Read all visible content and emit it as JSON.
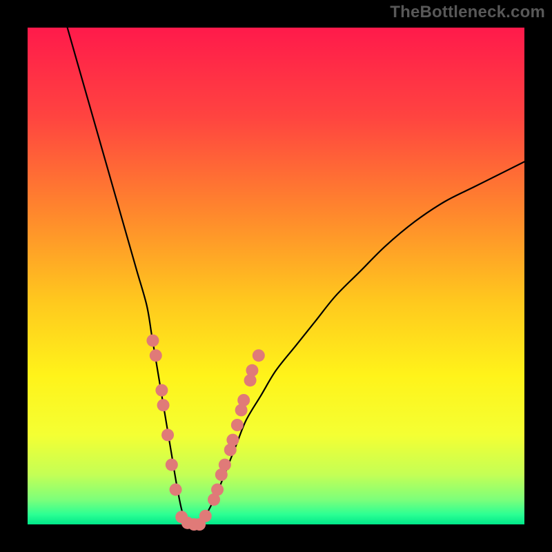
{
  "watermark": "TheBottleneck.com",
  "gradient_stops": [
    {
      "offset": 0,
      "color": "#ff1a4b"
    },
    {
      "offset": 18,
      "color": "#ff4440"
    },
    {
      "offset": 38,
      "color": "#ff8a2c"
    },
    {
      "offset": 55,
      "color": "#ffc81e"
    },
    {
      "offset": 70,
      "color": "#fff31a"
    },
    {
      "offset": 82,
      "color": "#f4ff33"
    },
    {
      "offset": 90,
      "color": "#c4ff55"
    },
    {
      "offset": 95,
      "color": "#7dff7a"
    },
    {
      "offset": 98,
      "color": "#2cff93"
    },
    {
      "offset": 100,
      "color": "#00e88a"
    }
  ],
  "curve_color": "#000000",
  "curve_width": 2.2,
  "dot_color": "#e07a78",
  "dot_radius": 9,
  "chart_data": {
    "type": "line",
    "title": "",
    "xlabel": "",
    "ylabel": "",
    "xlim": [
      0,
      100
    ],
    "ylim": [
      0,
      100
    ],
    "background_gradient_note": "vertical gradient red→orange→yellow→green represents high→low bottleneck",
    "series": [
      {
        "name": "bottleneck-curve",
        "x": [
          8,
          10,
          12,
          14,
          16,
          18,
          20,
          22,
          24,
          25,
          26,
          27,
          28,
          29,
          30,
          31,
          32,
          33,
          34,
          35,
          36,
          38,
          40,
          42,
          44,
          47,
          50,
          54,
          58,
          62,
          67,
          72,
          78,
          84,
          90,
          96,
          100
        ],
        "y": [
          100,
          93,
          86,
          79,
          72,
          65,
          58,
          51,
          44,
          38,
          32,
          26,
          20,
          14,
          8,
          3,
          0,
          0,
          0,
          0,
          2,
          6,
          11,
          16,
          21,
          26,
          31,
          36,
          41,
          46,
          51,
          56,
          61,
          65,
          68,
          71,
          73
        ]
      }
    ],
    "highlight_dots": [
      {
        "x": 25.2,
        "y": 37
      },
      {
        "x": 25.8,
        "y": 34
      },
      {
        "x": 27.0,
        "y": 27
      },
      {
        "x": 27.3,
        "y": 24
      },
      {
        "x": 28.2,
        "y": 18
      },
      {
        "x": 29.0,
        "y": 12
      },
      {
        "x": 29.8,
        "y": 7
      },
      {
        "x": 31.0,
        "y": 1.5
      },
      {
        "x": 32.2,
        "y": 0.3
      },
      {
        "x": 33.5,
        "y": 0.0
      },
      {
        "x": 34.6,
        "y": 0.0
      },
      {
        "x": 35.8,
        "y": 1.7
      },
      {
        "x": 37.5,
        "y": 5
      },
      {
        "x": 38.2,
        "y": 7
      },
      {
        "x": 39.0,
        "y": 10
      },
      {
        "x": 39.7,
        "y": 12
      },
      {
        "x": 40.8,
        "y": 15
      },
      {
        "x": 41.3,
        "y": 17
      },
      {
        "x": 42.2,
        "y": 20
      },
      {
        "x": 43.0,
        "y": 23
      },
      {
        "x": 43.5,
        "y": 25
      },
      {
        "x": 44.8,
        "y": 29
      },
      {
        "x": 45.2,
        "y": 31
      },
      {
        "x": 46.5,
        "y": 34
      }
    ]
  }
}
